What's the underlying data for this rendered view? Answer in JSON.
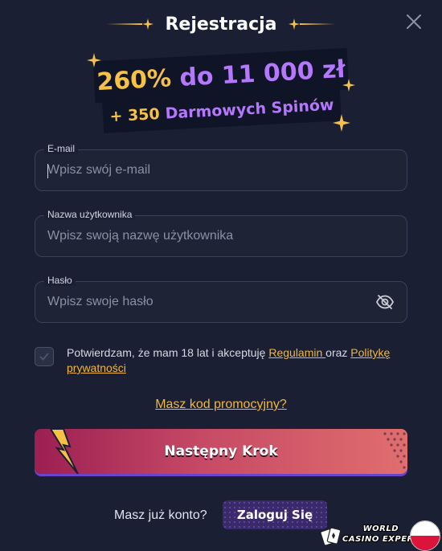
{
  "header": {
    "title": "Rejestracja"
  },
  "bonus": {
    "line1_percent": "260%",
    "line1_amount": "do 11 000 zł",
    "line2_plus": "+ 350",
    "line2_spins": "Darmowych Spinów"
  },
  "form": {
    "email": {
      "label": "E-mail",
      "placeholder": "Wpisz swój e-mail",
      "value": ""
    },
    "username": {
      "label": "Nazwa użytkownika",
      "placeholder": "Wpisz swoją nazwę użytkownika",
      "value": ""
    },
    "password": {
      "label": "Hasło",
      "placeholder": "Wpisz swoje hasło",
      "value": ""
    }
  },
  "consent": {
    "text_before": "Potwierdzam, że mam 18 lat i akceptuję ",
    "link_terms": "Regulamin ",
    "text_middle": "oraz ",
    "link_privacy": "Politykę prywatności",
    "checked": false
  },
  "promo": {
    "link_label": "Masz kod promocyjny?"
  },
  "next_button": {
    "label": "Następny Krok"
  },
  "footer": {
    "question": "Masz już konto?",
    "login_label": "Zaloguj Się"
  },
  "watermark": {
    "line1": "WORLD",
    "line2": "CASINO EXPERT"
  },
  "colors": {
    "background": "#1b1f33",
    "accent_gold": "#f2b736",
    "accent_purple": "#b677ff",
    "button_start": "#9c1f53",
    "button_end": "#e06e6e"
  },
  "icons": [
    "sparkle-icon",
    "close-icon",
    "eye-off-icon",
    "checkmark-icon",
    "lightning-bolt-icon",
    "cards-icon",
    "poland-flag-icon"
  ]
}
